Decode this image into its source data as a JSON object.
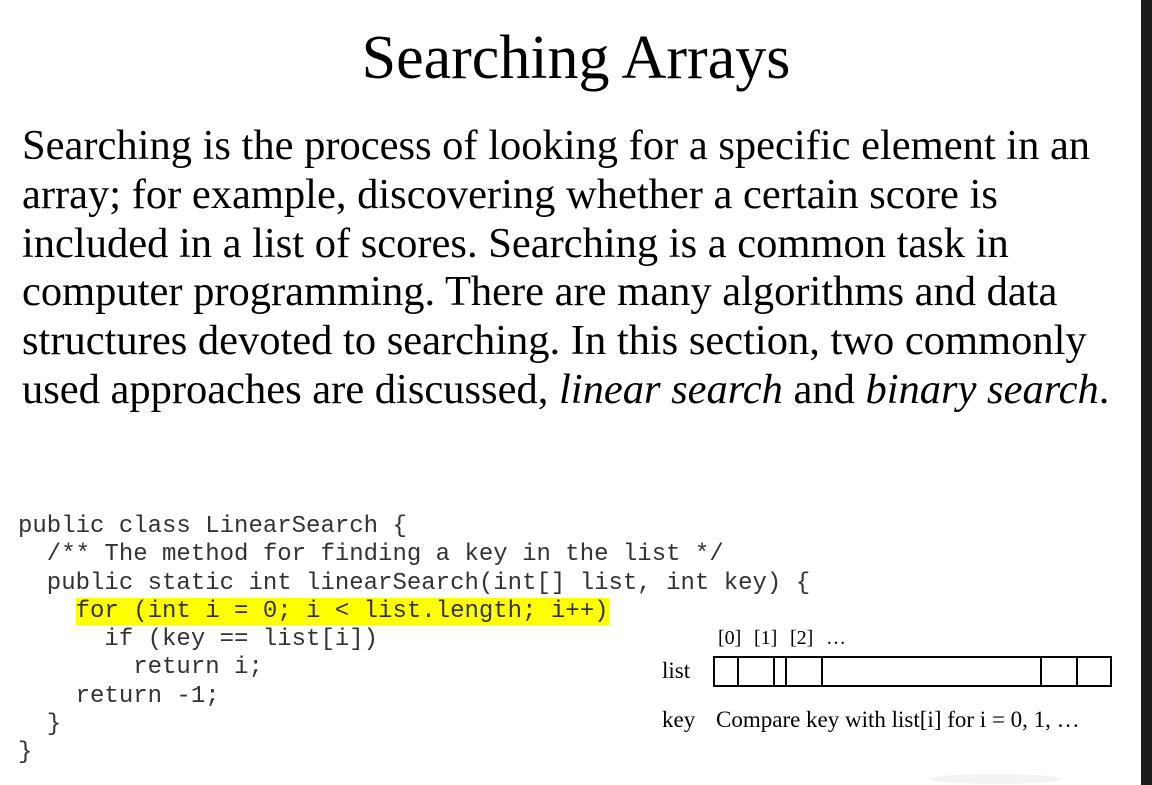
{
  "slide": {
    "title": "Searching Arrays",
    "paragraph": {
      "lead": "Searching is the process of looking for a specific element in an array; for example, discovering whether a certain score is included in a list of scores. Searching is a common task in computer programming. There are many algorithms and data structures devoted to searching. In this section, two commonly used approaches are discussed,",
      "term1": "linear search",
      "conj": " and",
      "term2": "binary search",
      "end": "."
    }
  },
  "code": {
    "highlight_color": "#ffff00",
    "lines": [
      "public class LinearSearch {",
      "  /** The method for finding a key in the list */",
      "  public static int linearSearch(int[] list, int key) {",
      "for (int i = 0; i < list.length; i++)",
      "      if (key == list[i])",
      "        return i;",
      "    return -1;",
      "  }",
      "}"
    ]
  },
  "diagram": {
    "indices": [
      "[0]",
      "[1]",
      "[2]",
      "…"
    ],
    "list_label": "list",
    "key_label": "key",
    "compare_text": "Compare key with list[i] for i = 0, 1, …"
  }
}
